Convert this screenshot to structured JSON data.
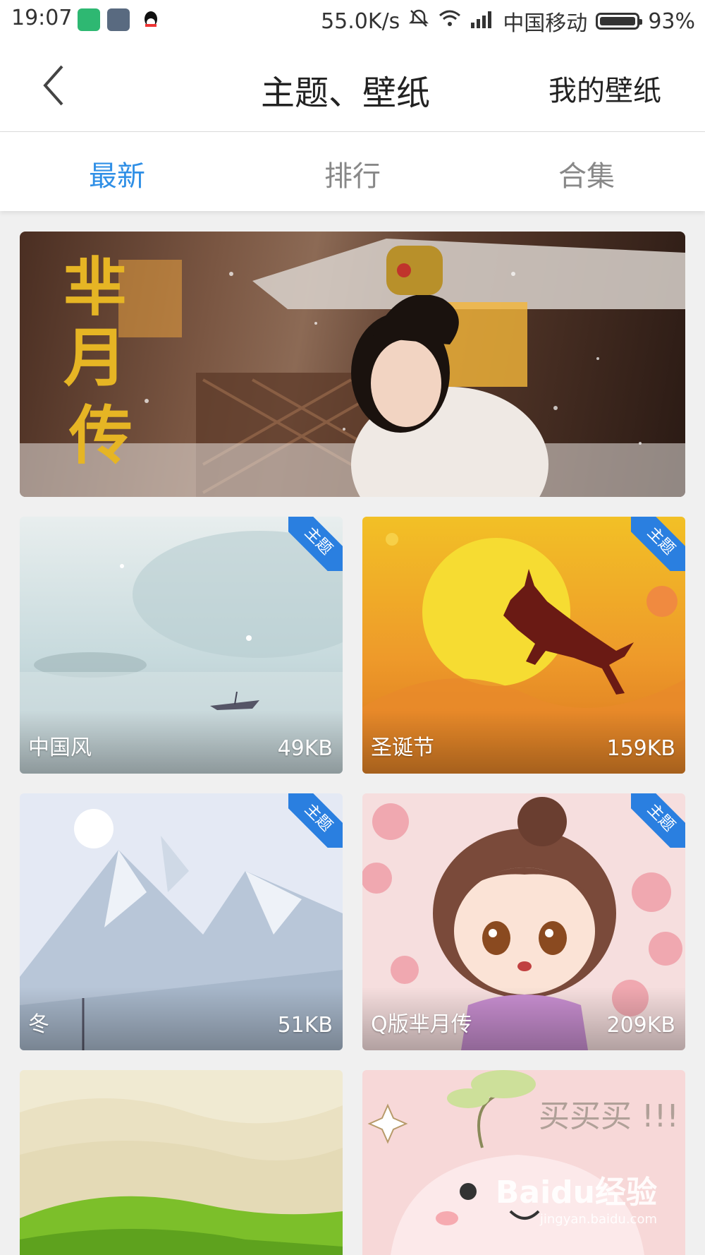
{
  "status_bar": {
    "time": "19:07",
    "net_speed": "55.0K/s",
    "carrier": "中国移动",
    "battery": "93%"
  },
  "header": {
    "title": "主题、壁纸",
    "my_wallpaper": "我的壁纸"
  },
  "tabs": [
    {
      "label": "最新",
      "active": true
    },
    {
      "label": "排行",
      "active": false
    },
    {
      "label": "合集",
      "active": false
    }
  ],
  "banner": {
    "calligraphy": "芈月传"
  },
  "cards": [
    {
      "label": "中国风",
      "size": "49KB",
      "badge": "主题"
    },
    {
      "label": "圣诞节",
      "size": "159KB",
      "badge": "主题"
    },
    {
      "label": "冬",
      "size": "51KB",
      "badge": "主题"
    },
    {
      "label": "Q版芈月传",
      "size": "209KB",
      "badge": "主题"
    },
    {
      "label": "",
      "size": "",
      "badge": ""
    },
    {
      "label": "",
      "size": "",
      "badge": "",
      "art_text": "买买买 !!!"
    }
  ],
  "watermark": {
    "brand": "Baidu经验",
    "url": "jingyan.baidu.com"
  },
  "colors": {
    "accent": "#2f8fe6",
    "badge": "#2a7fe0"
  }
}
